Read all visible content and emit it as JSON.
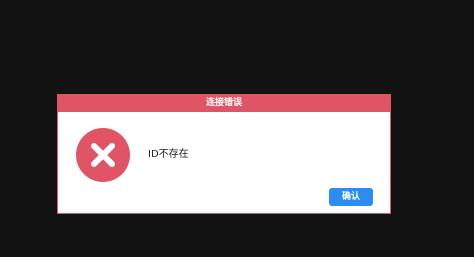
{
  "dialog": {
    "title": "连接错误",
    "message": "ID不存在",
    "confirm_label": "确认",
    "icon": "error-x-icon"
  },
  "colors": {
    "background": "#121212",
    "accent": "#e05566",
    "button": "#2d8cf0"
  }
}
